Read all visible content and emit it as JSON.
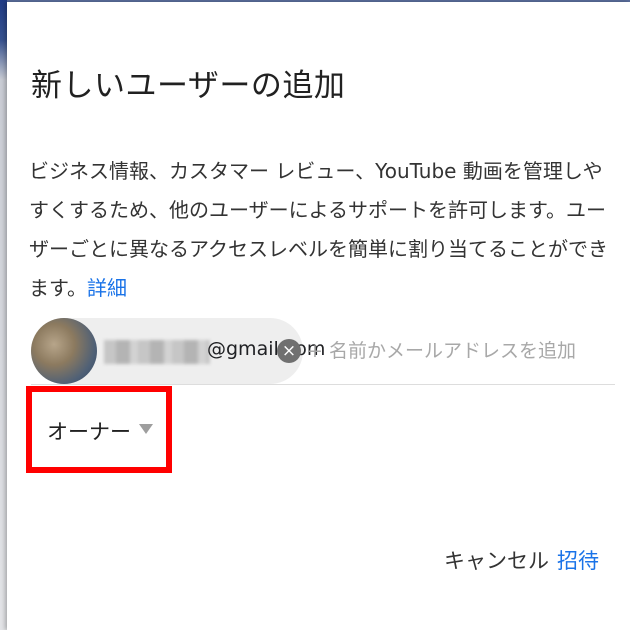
{
  "dialog": {
    "title": "新しいユーザーの追加",
    "description": "ビジネス情報、カスタマー レビュー、YouTube 動画を管理しやすくするため、他のユーザーによるサポートを許可します。ユーザーごとに異なるアクセスレベルを簡単に割り当てることができます。",
    "details_link": "詳細"
  },
  "invitee": {
    "email_domain": "@gmail.com",
    "remove_icon": "close-icon"
  },
  "add_input": {
    "placeholder": "+ 名前かメールアドレスを追加"
  },
  "role": {
    "selected": "オーナー",
    "highlight_color": "#ff0000"
  },
  "actions": {
    "cancel": "キャンセル",
    "invite": "招待"
  },
  "colors": {
    "accent": "#1a73e8",
    "highlight": "#ff0000"
  }
}
